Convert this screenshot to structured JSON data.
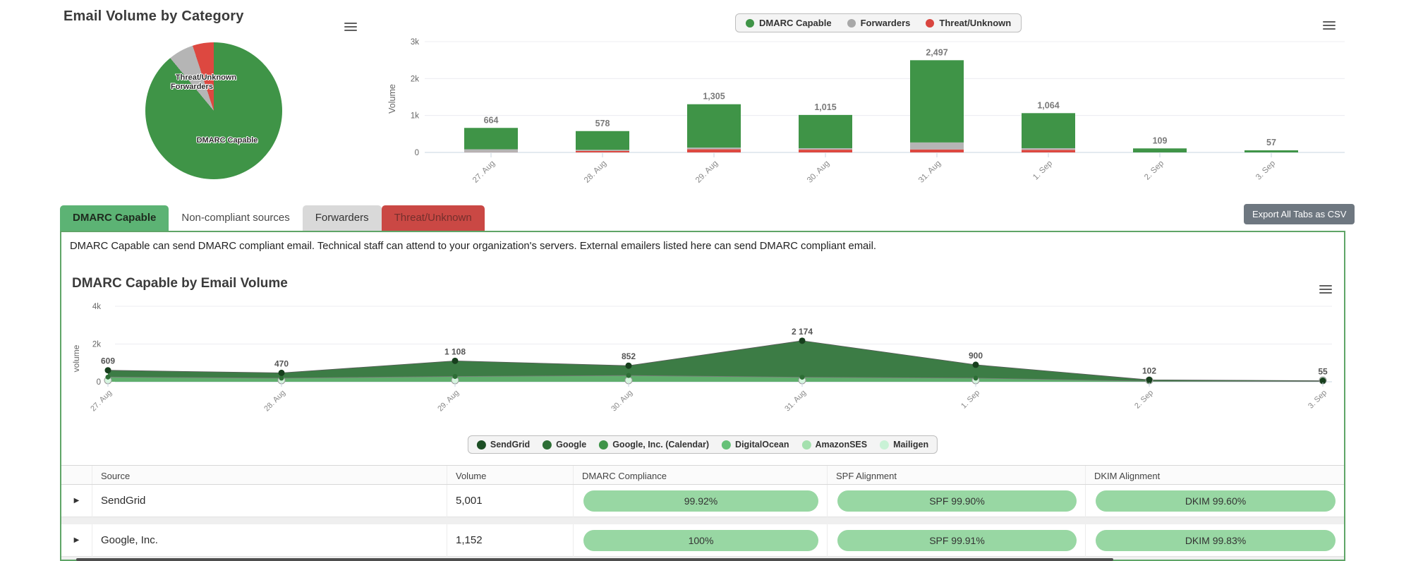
{
  "pie_section": {
    "title": "Email Volume by Category",
    "labels": {
      "threat": "Threat/Unknown",
      "forwarders": "Forwarders",
      "dmarc": "DMARC Capable"
    }
  },
  "bar_legend": {
    "items": [
      {
        "label": "DMARC Capable",
        "color": "#3f9447"
      },
      {
        "label": "Forwarders",
        "color": "#a8a8a8"
      },
      {
        "label": "Threat/Unknown",
        "color": "#d9453f"
      }
    ]
  },
  "tabs": {
    "items": [
      {
        "label": "DMARC Capable",
        "style": "active-green"
      },
      {
        "label": "Non-compliant sources",
        "style": "plain"
      },
      {
        "label": "Forwarders",
        "style": "gray"
      },
      {
        "label": "Threat/Unknown",
        "style": "red"
      }
    ],
    "export_label": "Export All Tabs as CSV"
  },
  "panel": {
    "description": "DMARC Capable can send DMARC compliant email. Technical staff can attend to your organization's servers. External emailers listed here can send DMARC compliant email."
  },
  "area_section": {
    "title": "DMARC Capable by Email Volume"
  },
  "area_legend": {
    "items": [
      {
        "label": "SendGrid",
        "color": "#1c4e24"
      },
      {
        "label": "Google",
        "color": "#2d6e35"
      },
      {
        "label": "Google, Inc. (Calendar)",
        "color": "#3f9449"
      },
      {
        "label": "DigitalOcean",
        "color": "#66c178"
      },
      {
        "label": "AmazonSES",
        "color": "#a4e0ae"
      },
      {
        "label": "Mailigen",
        "color": "#c9f2d6"
      }
    ]
  },
  "table": {
    "headers": [
      "Source",
      "Volume",
      "DMARC Compliance",
      "SPF Alignment",
      "DKIM Alignment"
    ],
    "rows": [
      {
        "source": "SendGrid",
        "volume": "5,001",
        "dmarc": "99.92%",
        "spf": "SPF 99.90%",
        "dkim": "DKIM 99.60%"
      },
      {
        "source": "Google, Inc.",
        "volume": "1,152",
        "dmarc": "100%",
        "spf": "SPF 99.91%",
        "dkim": "DKIM 99.83%"
      }
    ]
  },
  "chart_data": [
    {
      "type": "pie",
      "title": "Email Volume by Category",
      "labels": [
        "DMARC Capable",
        "Forwarders",
        "Threat/Unknown"
      ],
      "values_pct": [
        89,
        6,
        5
      ],
      "colors": [
        "#3f9447",
        "#b5b5b5",
        "#dd4840"
      ]
    },
    {
      "type": "bar",
      "stacked": true,
      "ylabel": "Volume",
      "ylim": [
        0,
        3000
      ],
      "grid": true,
      "legend_position": "top",
      "yticks": [
        {
          "label": "3k",
          "value": 3000
        },
        {
          "label": "2k",
          "value": 2000
        },
        {
          "label": "1k",
          "value": 1000
        },
        {
          "label": "0",
          "value": 0
        }
      ],
      "categories": [
        "27. Aug",
        "28. Aug",
        "29. Aug",
        "30. Aug",
        "31. Aug",
        "1. Sep",
        "2. Sep",
        "3. Sep"
      ],
      "totals": [
        664,
        578,
        1305,
        1015,
        2497,
        1064,
        109,
        57
      ],
      "total_labels": [
        "664",
        "578",
        "1,305",
        "1,015",
        "2,497",
        "1,064",
        "109",
        "57"
      ],
      "series": [
        {
          "name": "Threat/Unknown",
          "color": "#dd4840",
          "values": [
            5,
            40,
            85,
            75,
            80,
            70,
            0,
            0
          ]
        },
        {
          "name": "Forwarders",
          "color": "#b5b5b5",
          "values": [
            80,
            30,
            45,
            40,
            190,
            45,
            0,
            0
          ]
        },
        {
          "name": "DMARC Capable",
          "color": "#3f9447",
          "values": [
            579,
            508,
            1175,
            900,
            2227,
            949,
            109,
            57
          ]
        }
      ]
    },
    {
      "type": "area",
      "title": "DMARC Capable by Email Volume",
      "ylabel": "volume",
      "ylim": [
        0,
        4000
      ],
      "grid": true,
      "legend_position": "bottom",
      "yticks": [
        {
          "label": "4k",
          "value": 4000
        },
        {
          "label": "2k",
          "value": 2000
        },
        {
          "label": "0",
          "value": 0
        }
      ],
      "categories": [
        "27. Aug",
        "28. Aug",
        "29. Aug",
        "30. Aug",
        "31. Aug",
        "1. Sep",
        "2. Sep",
        "3. Sep"
      ],
      "series": [
        {
          "name": "SendGrid",
          "color": "#3c7c45",
          "dot": "#173f1d",
          "values": [
            609,
            470,
            1108,
            852,
            2174,
            900,
            102,
            55
          ],
          "labels": [
            "609",
            "470",
            "1 108",
            "852",
            "2 174",
            "900",
            "102",
            "55"
          ]
        },
        {
          "name": "Google",
          "color": "#5fae6c",
          "dot": "#2d6e35",
          "values": [
            250,
            190,
            280,
            330,
            240,
            190,
            30,
            15
          ],
          "labels": null
        }
      ],
      "near_zero_series": [
        "Google, Inc. (Calendar)",
        "DigitalOcean",
        "AmazonSES",
        "Mailigen"
      ]
    }
  ]
}
